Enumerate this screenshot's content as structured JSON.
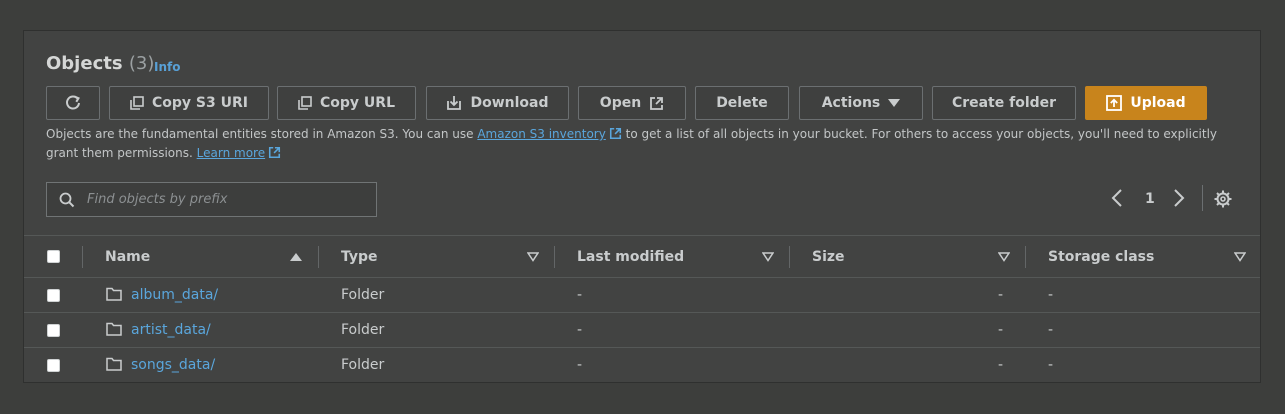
{
  "header": {
    "title": "Objects",
    "count": "(3)",
    "info_link": "Info"
  },
  "toolbar": {
    "refresh_icon": "refresh-icon",
    "copy_s3_uri": "Copy S3 URI",
    "copy_url": "Copy URL",
    "download": "Download",
    "open": "Open",
    "delete": "Delete",
    "actions": "Actions",
    "create_folder": "Create folder",
    "upload": "Upload"
  },
  "description": {
    "part1": "Objects are the fundamental entities stored in Amazon S3. You can use ",
    "link1": "Amazon S3 inventory",
    "part2": " to get a list of all objects in your bucket. For others to access your objects, you'll need to explicitly grant them permissions.",
    "link2": "Learn more"
  },
  "search": {
    "placeholder": "Find objects by prefix",
    "value": ""
  },
  "pagination": {
    "current_page": "1"
  },
  "table": {
    "columns": {
      "name": "Name",
      "type": "Type",
      "last_modified": "Last modified",
      "size": "Size",
      "storage_class": "Storage class"
    },
    "rows": [
      {
        "name": "album_data/",
        "type": "Folder",
        "last_modified": "-",
        "size": "-",
        "storage_class": "-"
      },
      {
        "name": "artist_data/",
        "type": "Folder",
        "last_modified": "-",
        "size": "-",
        "storage_class": "-"
      },
      {
        "name": "songs_data/",
        "type": "Folder",
        "last_modified": "-",
        "size": "-",
        "storage_class": "-"
      }
    ]
  },
  "colors": {
    "accent_link": "#5aa6dc",
    "upload_button": "#c8841c",
    "background": "#3d3e3c",
    "panel": "#424342"
  }
}
